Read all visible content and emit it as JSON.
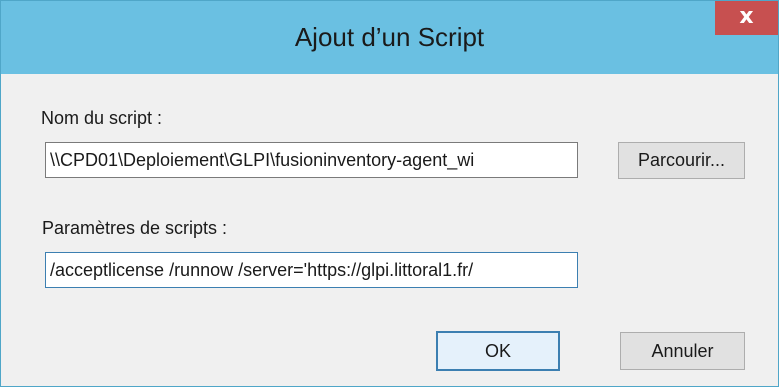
{
  "window": {
    "title": "Ajout d’un Script",
    "close_glyph": "x",
    "accent_color": "#6ac0e2",
    "close_color": "#c75050"
  },
  "form": {
    "script_name_label": "Nom du script :",
    "script_name_value": "\\\\CPD01\\Deploiement\\GLPI\\fusioninventory-agent_wi",
    "browse_label": "Parcourir...",
    "script_params_label": "Paramètres de scripts :",
    "script_params_value": "/acceptlicense /runnow /server='https://glpi.littoral1.fr/"
  },
  "buttons": {
    "ok_label": "OK",
    "cancel_label": "Annuler"
  }
}
